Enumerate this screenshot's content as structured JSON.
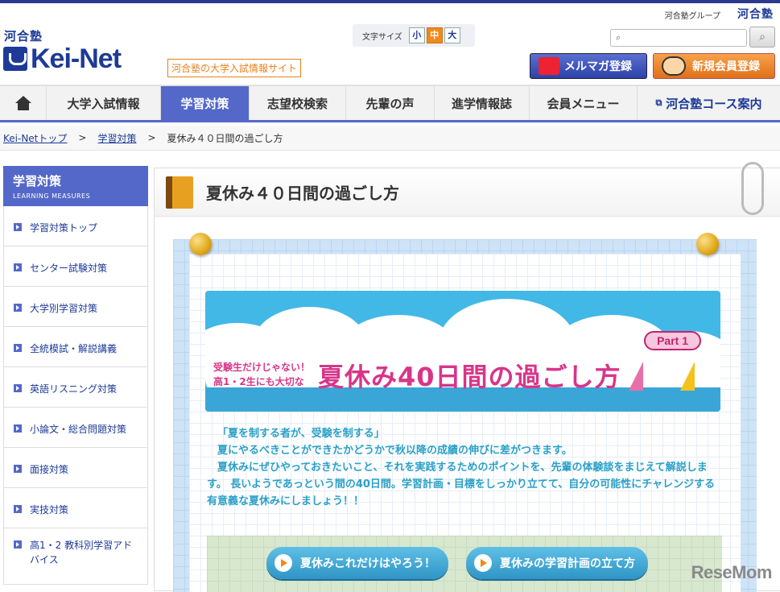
{
  "topbar": {
    "group_label": "河合塾グループ",
    "group_logo": "河合塾"
  },
  "header": {
    "logo_small": "河合塾",
    "logo_main": "Kei-Net",
    "tagline": "河合塾の大学入試情報サイト",
    "font_size_label": "文字サイズ",
    "font_sizes": [
      "小",
      "中",
      "大"
    ],
    "font_size_selected": "中",
    "search_placeholder": "",
    "mail_button": "メルマガ登録",
    "register_button": "新規会員登録"
  },
  "nav": {
    "items": [
      "大学入試情報",
      "学習対策",
      "志望校検索",
      "先輩の声",
      "進学情報誌",
      "会員メニュー"
    ],
    "active": "学習対策",
    "external": "河合塾コース案内"
  },
  "breadcrumb": [
    "Kei-Netトップ",
    "学習対策",
    "夏休み４０日間の過ごし方"
  ],
  "breadcrumb_sep": ">",
  "sidebar": {
    "title": "学習対策",
    "subtitle": "LEARNING MEASURES",
    "items": [
      "学習対策トップ",
      "センター試験対策",
      "大学別学習対策",
      "全統模試・解説講義",
      "英語リスニング対策",
      "小論文・総合問題対策",
      "面接対策",
      "実技対策",
      "高1・2 教科別学習アドバイス"
    ]
  },
  "main": {
    "title": "夏休み４０日間の過ごし方",
    "banner": {
      "sub1": "受験生だけじゃない！",
      "sub2": "高1・2生にも大切な",
      "main": "夏休み40日間の過ごし方",
      "part": "Part 1"
    },
    "lead": [
      "「夏を制する者が、受験を制する」",
      "夏にやるべきことができたかどうかで秋以降の成績の伸びに差がつきます。",
      "夏休みにぜひやっておきたいこと、それを実践するためのポイントを、先輩の体験談をまじえて解説します。 長いようであっという間の40日間。学習計画・目標をしっかり立てて、自分の可能性にチャレンジする有意義な夏休みにしましょう！！"
    ],
    "link1": "夏休みこれだけはやろう！",
    "link2": "夏休みの学習計画の立て方"
  },
  "watermark": "ReseMom",
  "colors": {
    "nav_active": "#5468c9",
    "brand": "#1d3a96",
    "accent": "#e8801c"
  }
}
